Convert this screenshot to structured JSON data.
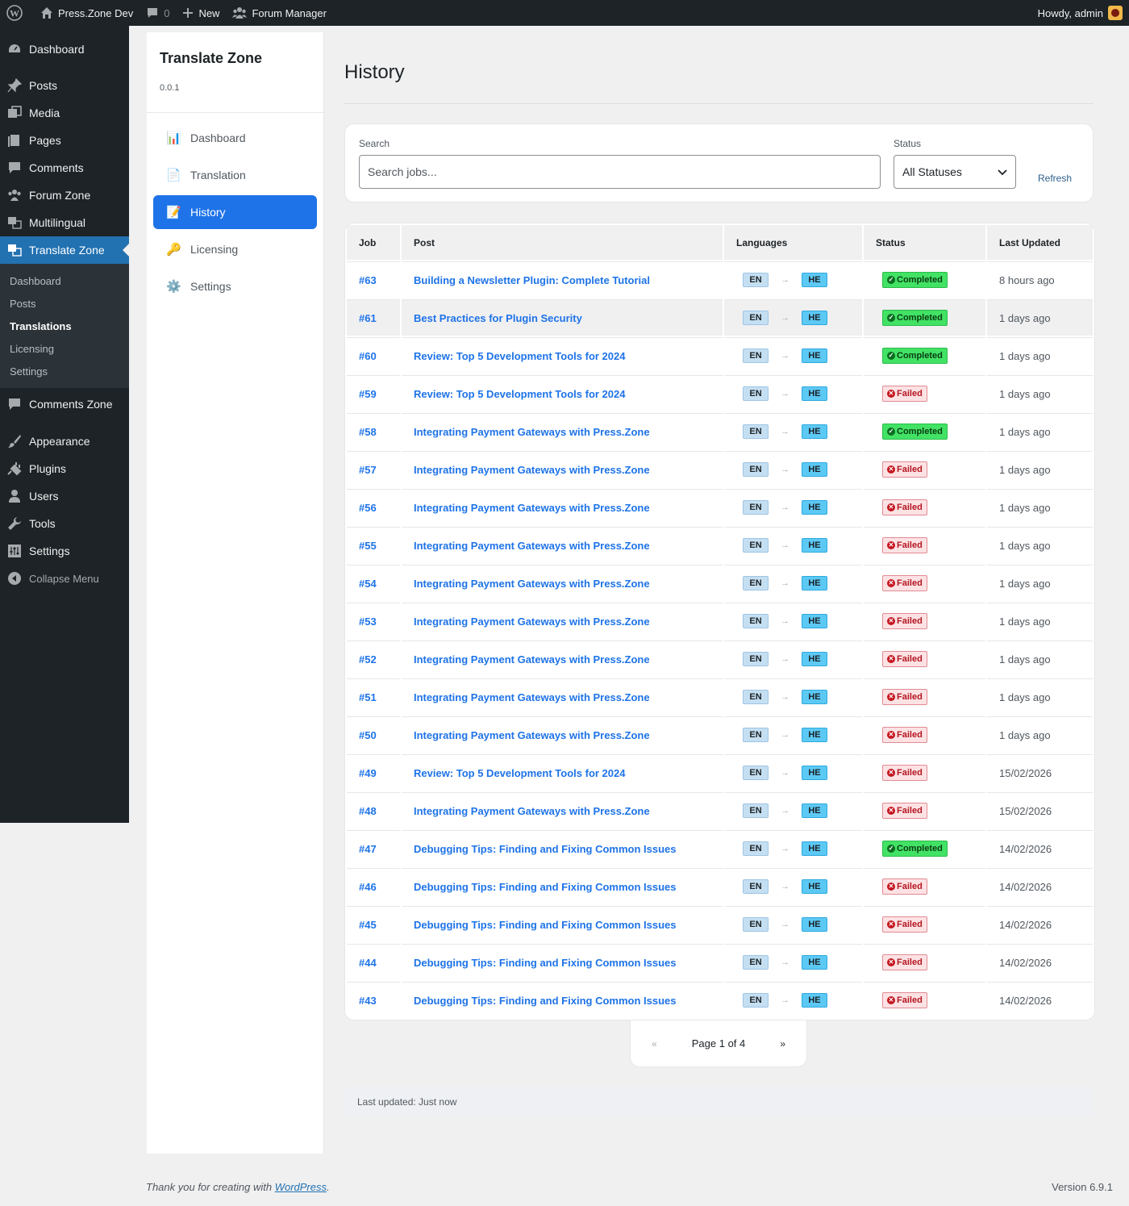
{
  "admin_bar": {
    "site_name": "Press.Zone Dev",
    "comments_count": "0",
    "new_label": "New",
    "forum_manager_label": "Forum Manager",
    "howdy": "Howdy, admin"
  },
  "admin_menu": {
    "items_top": [
      {
        "label": "Dashboard",
        "icon": "dashboard-icon"
      }
    ],
    "items_main": [
      {
        "label": "Posts",
        "icon": "pin-icon"
      },
      {
        "label": "Media",
        "icon": "media-icon"
      },
      {
        "label": "Pages",
        "icon": "pages-icon"
      },
      {
        "label": "Comments",
        "icon": "comment-icon"
      },
      {
        "label": "Forum Zone",
        "icon": "groups-icon"
      },
      {
        "label": "Multilingual",
        "icon": "translation-icon"
      }
    ],
    "current": {
      "label": "Translate Zone",
      "icon": "translation-icon"
    },
    "submenu": [
      "Dashboard",
      "Posts",
      "Translations",
      "Licensing",
      "Settings"
    ],
    "submenu_current_index": 2,
    "items_after": [
      {
        "label": "Comments Zone",
        "icon": "comment-icon"
      }
    ],
    "items_bottom": [
      {
        "label": "Appearance",
        "icon": "brush-icon"
      },
      {
        "label": "Plugins",
        "icon": "plugin-icon"
      },
      {
        "label": "Users",
        "icon": "user-icon"
      },
      {
        "label": "Tools",
        "icon": "wrench-icon"
      },
      {
        "label": "Settings",
        "icon": "settings-icon"
      }
    ],
    "collapse_label": "Collapse Menu"
  },
  "plugin_nav": {
    "title": "Translate Zone",
    "version": "0.0.1",
    "items": [
      {
        "label": "Dashboard",
        "icon": "📊"
      },
      {
        "label": "Translation",
        "icon": "📄"
      },
      {
        "label": "History",
        "icon": "📝"
      },
      {
        "label": "Licensing",
        "icon": "🔑"
      },
      {
        "label": "Settings",
        "icon": "⚙️"
      }
    ],
    "active_index": 2
  },
  "page": {
    "title": "History",
    "filters": {
      "search_label": "Search",
      "search_placeholder": "Search jobs...",
      "search_value": "",
      "status_label": "Status",
      "status_value": "All Statuses",
      "refresh_label": "Refresh"
    },
    "table": {
      "headers": [
        "Job",
        "Post",
        "Languages",
        "Status",
        "Last Updated"
      ],
      "highlighted_row": 1,
      "rows": [
        {
          "job": "#63",
          "post": "Building a Newsletter Plugin: Complete Tutorial",
          "from": "EN",
          "to": "HE",
          "status": "Completed",
          "updated": "8 hours ago"
        },
        {
          "job": "#61",
          "post": "Best Practices for Plugin Security",
          "from": "EN",
          "to": "HE",
          "status": "Completed",
          "updated": "1 days ago"
        },
        {
          "job": "#60",
          "post": "Review: Top 5 Development Tools for 2024",
          "from": "EN",
          "to": "HE",
          "status": "Completed",
          "updated": "1 days ago"
        },
        {
          "job": "#59",
          "post": "Review: Top 5 Development Tools for 2024",
          "from": "EN",
          "to": "HE",
          "status": "Failed",
          "updated": "1 days ago"
        },
        {
          "job": "#58",
          "post": "Integrating Payment Gateways with Press.Zone",
          "from": "EN",
          "to": "HE",
          "status": "Completed",
          "updated": "1 days ago"
        },
        {
          "job": "#57",
          "post": "Integrating Payment Gateways with Press.Zone",
          "from": "EN",
          "to": "HE",
          "status": "Failed",
          "updated": "1 days ago"
        },
        {
          "job": "#56",
          "post": "Integrating Payment Gateways with Press.Zone",
          "from": "EN",
          "to": "HE",
          "status": "Failed",
          "updated": "1 days ago"
        },
        {
          "job": "#55",
          "post": "Integrating Payment Gateways with Press.Zone",
          "from": "EN",
          "to": "HE",
          "status": "Failed",
          "updated": "1 days ago"
        },
        {
          "job": "#54",
          "post": "Integrating Payment Gateways with Press.Zone",
          "from": "EN",
          "to": "HE",
          "status": "Failed",
          "updated": "1 days ago"
        },
        {
          "job": "#53",
          "post": "Integrating Payment Gateways with Press.Zone",
          "from": "EN",
          "to": "HE",
          "status": "Failed",
          "updated": "1 days ago"
        },
        {
          "job": "#52",
          "post": "Integrating Payment Gateways with Press.Zone",
          "from": "EN",
          "to": "HE",
          "status": "Failed",
          "updated": "1 days ago"
        },
        {
          "job": "#51",
          "post": "Integrating Payment Gateways with Press.Zone",
          "from": "EN",
          "to": "HE",
          "status": "Failed",
          "updated": "1 days ago"
        },
        {
          "job": "#50",
          "post": "Integrating Payment Gateways with Press.Zone",
          "from": "EN",
          "to": "HE",
          "status": "Failed",
          "updated": "1 days ago"
        },
        {
          "job": "#49",
          "post": "Review: Top 5 Development Tools for 2024",
          "from": "EN",
          "to": "HE",
          "status": "Failed",
          "updated": "15/02/2026"
        },
        {
          "job": "#48",
          "post": "Integrating Payment Gateways with Press.Zone",
          "from": "EN",
          "to": "HE",
          "status": "Failed",
          "updated": "15/02/2026"
        },
        {
          "job": "#47",
          "post": "Debugging Tips: Finding and Fixing Common Issues",
          "from": "EN",
          "to": "HE",
          "status": "Completed",
          "updated": "14/02/2026"
        },
        {
          "job": "#46",
          "post": "Debugging Tips: Finding and Fixing Common Issues",
          "from": "EN",
          "to": "HE",
          "status": "Failed",
          "updated": "14/02/2026"
        },
        {
          "job": "#45",
          "post": "Debugging Tips: Finding and Fixing Common Issues",
          "from": "EN",
          "to": "HE",
          "status": "Failed",
          "updated": "14/02/2026"
        },
        {
          "job": "#44",
          "post": "Debugging Tips: Finding and Fixing Common Issues",
          "from": "EN",
          "to": "HE",
          "status": "Failed",
          "updated": "14/02/2026"
        },
        {
          "job": "#43",
          "post": "Debugging Tips: Finding and Fixing Common Issues",
          "from": "EN",
          "to": "HE",
          "status": "Failed",
          "updated": "14/02/2026"
        }
      ]
    },
    "pagination": {
      "prev": "«",
      "label": "Page 1 of 4",
      "next": "»"
    },
    "last_updated": "Last updated: Just now"
  },
  "footer": {
    "thanks_prefix": "Thank you for creating with ",
    "thanks_link": "WordPress",
    "thanks_suffix": ".",
    "version": "Version 6.9.1"
  },
  "colors": {
    "admin_dark": "#1d2327",
    "wp_blue": "#2271b1",
    "accent_blue": "#1e73e8",
    "completed_green": "#42e265",
    "failed_red": "#c4161f"
  }
}
